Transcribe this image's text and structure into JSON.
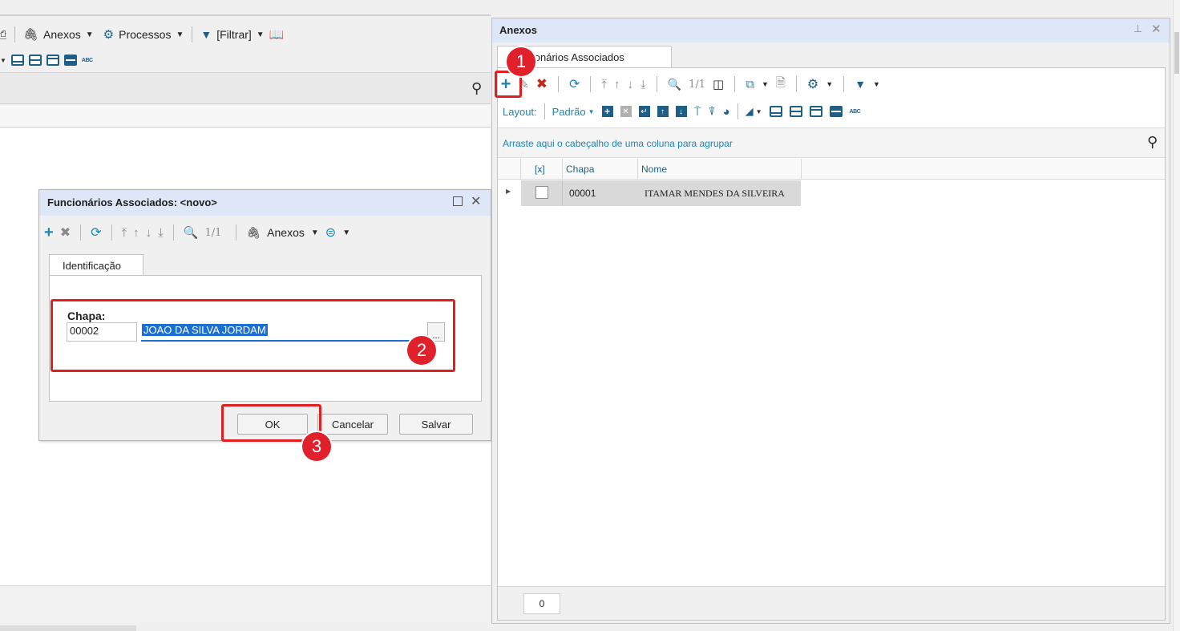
{
  "left_toolbar": {
    "anexos_label": "Anexos",
    "processos_label": "Processos",
    "filtrar_label": "[Filtrar]",
    "abc": "ABC"
  },
  "anexos_panel": {
    "title": "Anexos",
    "tab_label": "Funcionários Associados",
    "page_indicator": "1/1",
    "layout_label": "Layout:",
    "layout_value": "Padrão",
    "abc": "ABC",
    "group_hint": "Arraste aqui o cabeçalho de uma coluna para agrupar",
    "columns": [
      "[x]",
      "Chapa",
      "Nome"
    ],
    "rows": [
      {
        "chapa": "00001",
        "nome": "ITAMAR MENDES DA SILVEIRA"
      }
    ],
    "footer_count": "0"
  },
  "dialog": {
    "title": "Funcionários Associados: <novo>",
    "page_indicator": "1/1",
    "anexos_label": "Anexos",
    "tab_label": "Identificação",
    "field_label": "Chapa:",
    "chapa_value": "00002",
    "nome_value": "JOAO DA SILVA JORDAM",
    "lookup_button": "...",
    "ok_label": "OK",
    "cancel_label": "Cancelar",
    "save_label": "Salvar"
  },
  "badges": {
    "one": "1",
    "two": "2",
    "three": "3"
  },
  "colors": {
    "accent": "#1f86b0",
    "delete_red": "#c0281c",
    "highlight_box": "#e02020",
    "panel_header": "#dde7f7",
    "selection": "#1c6fd1"
  }
}
